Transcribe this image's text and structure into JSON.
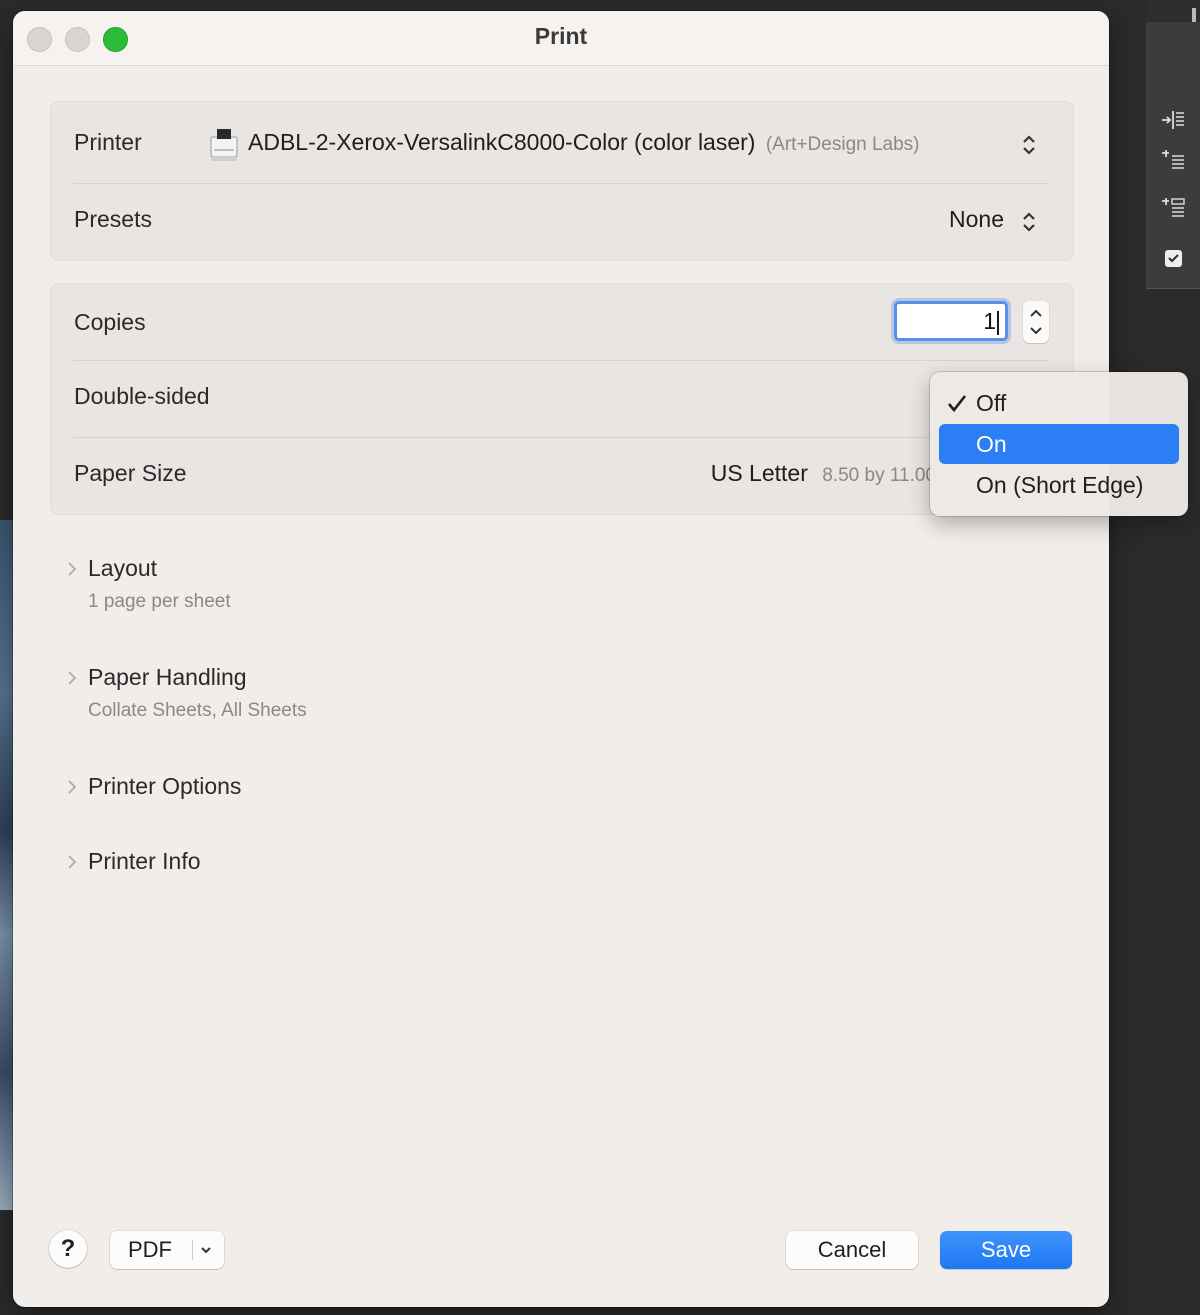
{
  "dialog": {
    "title": "Print"
  },
  "printer": {
    "label": "Printer",
    "name": "ADBL-2-Xerox-VersalinkC8000-Color (color laser)",
    "location": "(Art+Design Labs)"
  },
  "presets": {
    "label": "Presets",
    "value": "None"
  },
  "copies": {
    "label": "Copies",
    "value": "1"
  },
  "double_sided": {
    "label": "Double-sided",
    "menu": {
      "checked_item": "Off",
      "highlighted_item": "On",
      "items": [
        {
          "label": "Off",
          "checked": true
        },
        {
          "label": "On",
          "checked": false
        },
        {
          "label": "On (Short Edge)",
          "checked": false
        }
      ]
    }
  },
  "paper_size": {
    "label": "Paper Size",
    "value": "US Letter",
    "dimensions": "8.50 by 11.00"
  },
  "sections": [
    {
      "title": "Layout",
      "subtitle": "1 page per sheet"
    },
    {
      "title": "Paper Handling",
      "subtitle": "Collate Sheets, All Sheets"
    },
    {
      "title": "Printer Options",
      "subtitle": ""
    },
    {
      "title": "Printer Info",
      "subtitle": ""
    }
  ],
  "footer": {
    "help_label": "?",
    "pdf_label": "PDF",
    "cancel_label": "Cancel",
    "save_label": "Save"
  },
  "colors": {
    "accent": "#2b7ef4",
    "zoom_button": "#2bbd3a"
  },
  "background_toolbar": {
    "icons": [
      "indent-right-icon",
      "insert-above-icon",
      "insert-below-icon",
      "checkbox-icon"
    ]
  }
}
